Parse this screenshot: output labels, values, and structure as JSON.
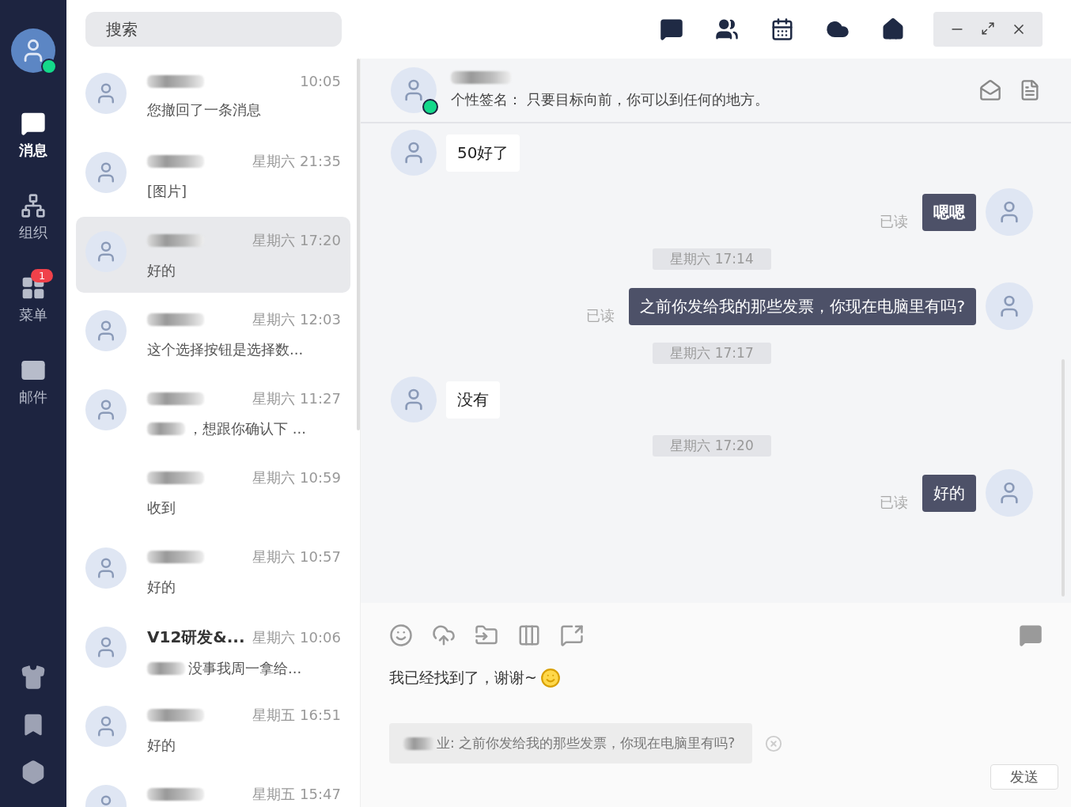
{
  "nav": {
    "items": [
      {
        "kind": "chat",
        "label": "消息",
        "selected": true
      },
      {
        "kind": "org",
        "label": "组织",
        "selected": false
      },
      {
        "kind": "menu",
        "label": "菜单",
        "selected": false,
        "badge": "1"
      },
      {
        "kind": "mail",
        "label": "邮件",
        "selected": false
      }
    ]
  },
  "search": {
    "placeholder": "搜索"
  },
  "conversations": [
    {
      "time": "10:05",
      "preview": "您撤回了一条消息",
      "selected": false,
      "avatar": true
    },
    {
      "time": "星期六 21:35",
      "preview": "[图片]",
      "selected": false,
      "avatar": true
    },
    {
      "time": "星期六 17:20",
      "preview": "好的",
      "selected": true,
      "avatar": true
    },
    {
      "time": "星期六 12:03",
      "preview": "这个选择按钮是选择数...",
      "selected": false,
      "avatar": true
    },
    {
      "time": "星期六 11:27",
      "preview": "，想跟你确认下 ...",
      "preview_redacted": true,
      "selected": false,
      "avatar": true
    },
    {
      "time": "星期六 10:59",
      "preview": "收到",
      "selected": false,
      "avatar": false
    },
    {
      "time": "星期六 10:57",
      "preview": "好的",
      "selected": false,
      "avatar": true
    },
    {
      "name": "V12研发&...",
      "time": "星期六 10:06",
      "preview": "没事我周一拿给...",
      "preview_redacted": true,
      "selected": false,
      "avatar": true
    },
    {
      "time": "星期五 16:51",
      "preview": "好的",
      "selected": false,
      "avatar": true
    },
    {
      "time": "星期五 15:47",
      "selected": false,
      "avatar": true
    }
  ],
  "contact": {
    "signature": "个性签名： 只要目标向前，你可以到任何的地方。",
    "online": true
  },
  "messages": [
    {
      "kind": "incoming",
      "text": "50好了"
    },
    {
      "kind": "outgoing",
      "text": "嗯嗯",
      "status": "已读",
      "bold": true
    },
    {
      "kind": "time",
      "text": "星期六 17:14"
    },
    {
      "kind": "outgoing",
      "text": "之前你发给我的那些发票，你现在电脑里有吗?",
      "status": "已读",
      "bold": false
    },
    {
      "kind": "time",
      "text": "星期六 17:17"
    },
    {
      "kind": "incoming",
      "text": "没有"
    },
    {
      "kind": "time",
      "text": "星期六 17:20"
    },
    {
      "kind": "outgoing",
      "text": "好的",
      "status": "已读",
      "bold": false
    }
  ],
  "composer": {
    "value": "我已经找到了，谢谢~",
    "quote": "业: 之前你发给我的那些发票，你现在电脑里有吗?",
    "send": "发送"
  }
}
